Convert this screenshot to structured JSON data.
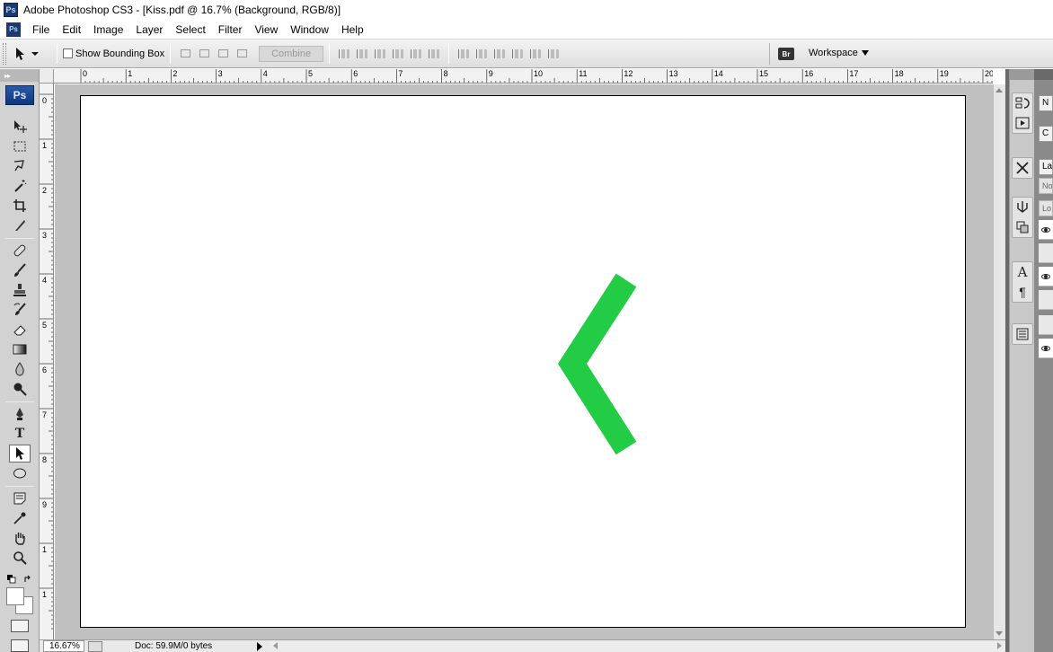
{
  "window": {
    "title": "Adobe Photoshop CS3 - [Kiss.pdf @ 16.7% (Background, RGB/8)]",
    "app_icon_text": "Ps",
    "doc_icon_text": "Ps"
  },
  "menu": {
    "items": [
      "File",
      "Edit",
      "Image",
      "Layer",
      "Select",
      "Filter",
      "View",
      "Window",
      "Help"
    ]
  },
  "options_bar": {
    "show_bounding_box_label": "Show Bounding Box",
    "show_bounding_box_checked": false,
    "combine_label": "Combine",
    "bridge_icon_text": "Br",
    "workspace_label": "Workspace"
  },
  "toolbox": {
    "logo_text": "Ps",
    "active_tool": "direct-selection-tool",
    "foreground_color": "#ffffff",
    "background_color": "#ffffff"
  },
  "rulers": {
    "horizontal_labels": [
      "0",
      "1",
      "2",
      "3",
      "4",
      "5",
      "6",
      "7",
      "8",
      "9",
      "10",
      "11",
      "12",
      "13",
      "14",
      "15",
      "16",
      "17",
      "18",
      "19",
      "20"
    ],
    "vertical_labels": [
      "0",
      "1",
      "2",
      "3",
      "4",
      "5",
      "6",
      "7",
      "8",
      "9",
      "1",
      "1"
    ]
  },
  "canvas": {
    "shape_color": "#22cc44",
    "pasteboard_color": "#c0c0c0"
  },
  "statusbar": {
    "zoom": "16.67%",
    "doc_info": "Doc: 59.9M/0 bytes"
  },
  "panels": {
    "tab_labels": [
      "N",
      "C",
      "La"
    ],
    "field_labels": [
      "No",
      "Lo"
    ]
  }
}
